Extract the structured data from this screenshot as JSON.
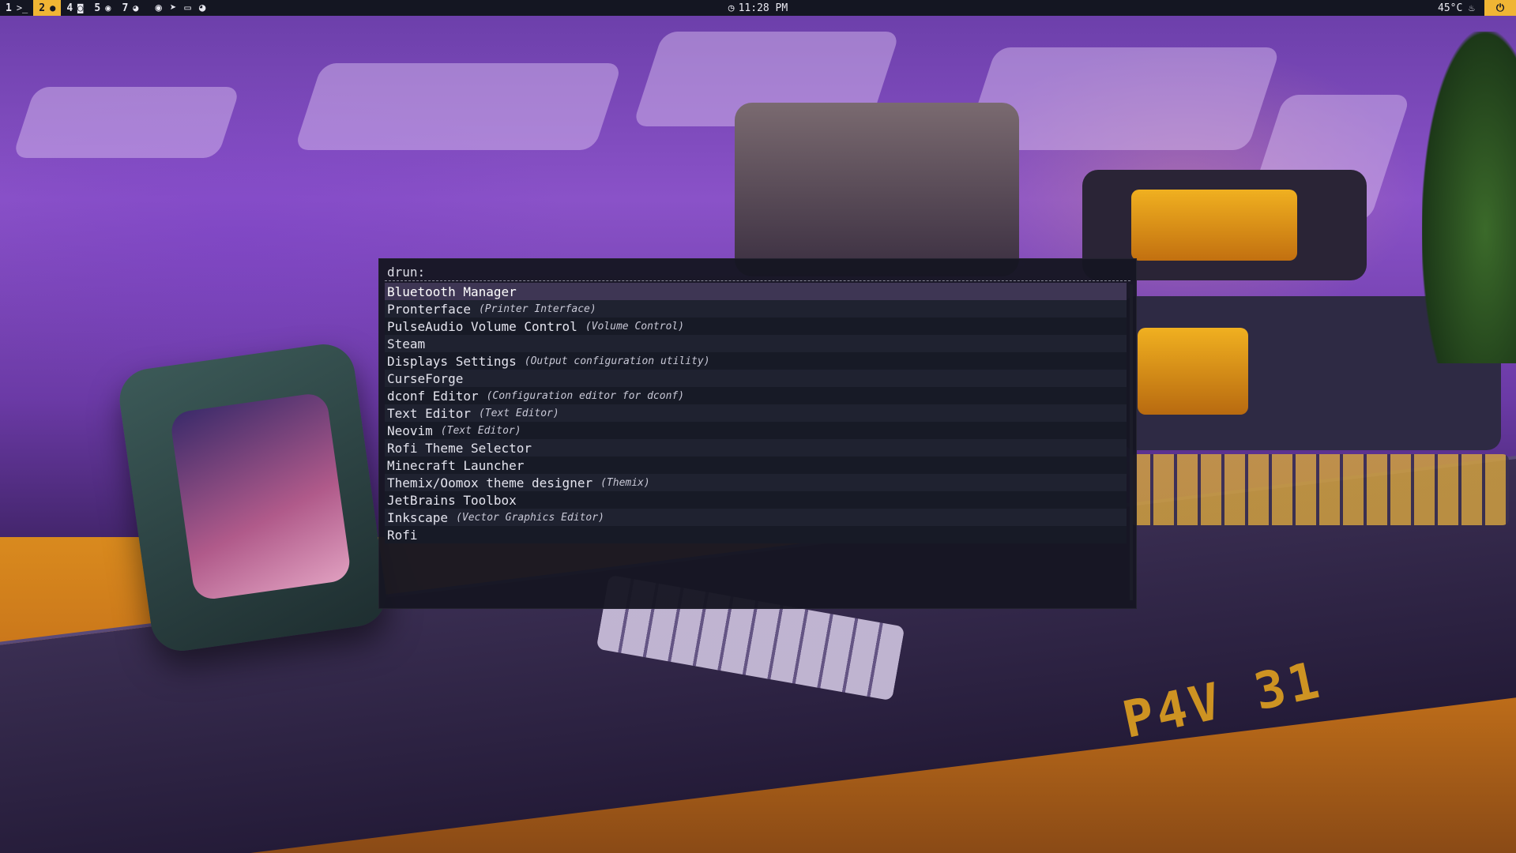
{
  "topbar": {
    "workspaces": [
      {
        "number": "1",
        "icon": "terminal-icon",
        "glyph": ">_",
        "active": false
      },
      {
        "number": "2",
        "icon": "firefox-icon",
        "glyph": "●",
        "active": true
      },
      {
        "number": "4",
        "icon": "camera-icon",
        "glyph": "◙",
        "active": false
      },
      {
        "number": "5",
        "icon": "steam-icon",
        "glyph": "◉",
        "active": false
      },
      {
        "number": "7",
        "icon": "discord-icon",
        "glyph": "◕",
        "active": false
      }
    ],
    "tray": [
      {
        "name": "steam-tray-icon",
        "glyph": "◉"
      },
      {
        "name": "telegram-tray-icon",
        "glyph": "➤"
      },
      {
        "name": "window-tray-icon",
        "glyph": "▭"
      },
      {
        "name": "discord-tray-icon",
        "glyph": "◕"
      }
    ],
    "clock": "11:28 PM",
    "temperature": "45°C",
    "accent": "#f0b534",
    "background": "#141622"
  },
  "launcher": {
    "prompt": "drun:",
    "query": "",
    "selected_index": 0,
    "items": [
      {
        "name": "Bluetooth Manager",
        "generic": ""
      },
      {
        "name": "Pronterface",
        "generic": "(Printer Interface)"
      },
      {
        "name": "PulseAudio Volume Control",
        "generic": "(Volume Control)"
      },
      {
        "name": "Steam",
        "generic": ""
      },
      {
        "name": "Displays Settings",
        "generic": "(Output configuration utility)"
      },
      {
        "name": "CurseForge",
        "generic": ""
      },
      {
        "name": "dconf Editor",
        "generic": "(Configuration editor for dconf)"
      },
      {
        "name": "Text Editor",
        "generic": "(Text Editor)"
      },
      {
        "name": "Neovim",
        "generic": "(Text Editor)"
      },
      {
        "name": "Rofi Theme Selector",
        "generic": ""
      },
      {
        "name": "Minecraft Launcher",
        "generic": ""
      },
      {
        "name": "Themix/Oomox theme designer",
        "generic": "(Themix)"
      },
      {
        "name": "JetBrains Toolbox",
        "generic": ""
      },
      {
        "name": "Inkscape",
        "generic": "(Vector Graphics Editor)"
      },
      {
        "name": "Rofi",
        "generic": ""
      }
    ]
  },
  "wallpaper": {
    "logo_text": "P4V 31"
  }
}
